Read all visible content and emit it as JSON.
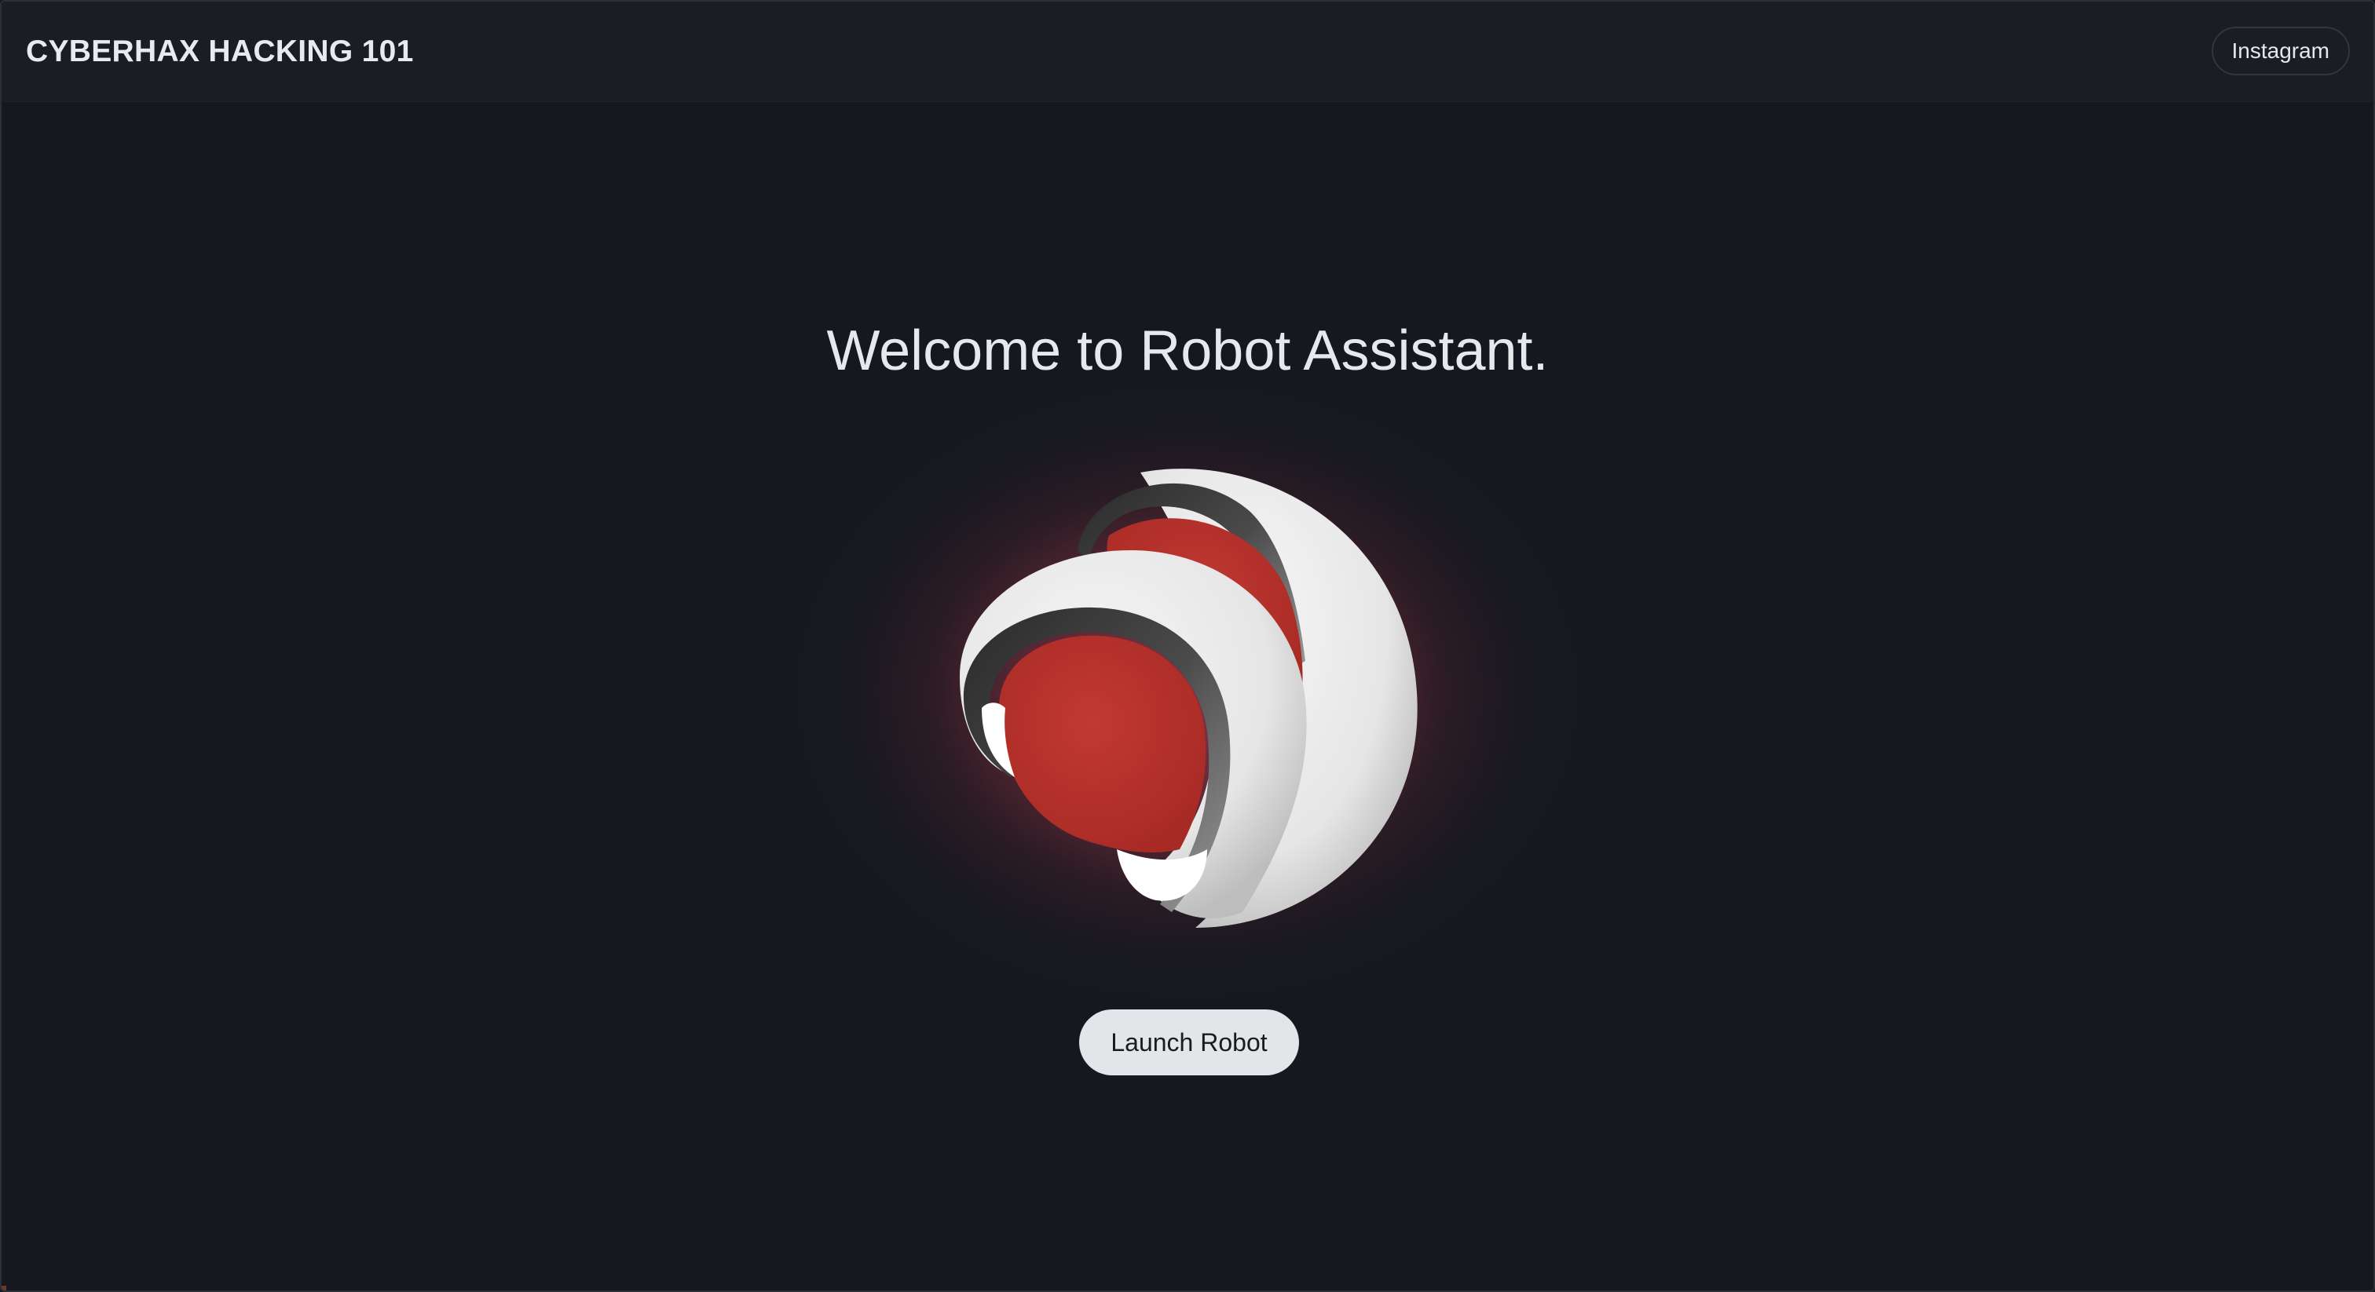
{
  "header": {
    "brand": "CYBERHAX HACKING 101",
    "instagram_label": "Instagram"
  },
  "hero": {
    "title": "Welcome to Robot Assistant.",
    "launch_label": "Launch Robot",
    "orb_icon": "robot-orb-logo"
  },
  "colors": {
    "background": "#161820",
    "header_bg": "#1b1d25",
    "accent_red": "#b8322c",
    "glow": "#a53e50",
    "button_bg": "#e4e5e9"
  }
}
